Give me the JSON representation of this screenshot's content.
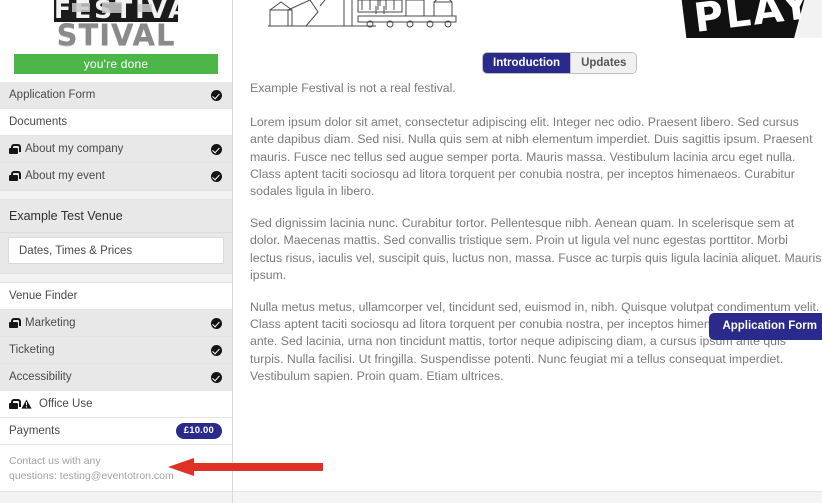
{
  "sidebar": {
    "logo": {
      "line1": "FESTIVAL",
      "line2": "STIVAL",
      "alt": "Example Festival logo"
    },
    "status_banner": {
      "label": "you're done",
      "color": "#4cb748"
    },
    "groups": [
      {
        "items": [
          {
            "label": "Application Form",
            "locked": false,
            "warning": false,
            "complete": true,
            "shaded": true
          },
          {
            "label": "Documents",
            "locked": false,
            "warning": false,
            "complete": false,
            "shaded": false
          },
          {
            "label": "About my company",
            "locked": true,
            "warning": false,
            "complete": true,
            "shaded": true
          },
          {
            "label": "About my event",
            "locked": true,
            "warning": false,
            "complete": true,
            "shaded": true
          }
        ]
      }
    ],
    "venue": {
      "title": "Example Test Venue",
      "sub_items": [
        {
          "label": "Dates, Times & Prices"
        }
      ]
    },
    "groups2": {
      "items": [
        {
          "label": "Venue Finder",
          "locked": false,
          "warning": false,
          "complete": false,
          "shaded": false
        },
        {
          "label": "Marketing",
          "locked": true,
          "warning": false,
          "complete": true,
          "shaded": true
        },
        {
          "label": "Ticketing",
          "locked": false,
          "warning": false,
          "complete": true,
          "shaded": true
        },
        {
          "label": "Accessibility",
          "locked": false,
          "warning": false,
          "complete": true,
          "shaded": true
        },
        {
          "label": "Office Use",
          "locked": true,
          "warning": true,
          "complete": false,
          "shaded": false
        }
      ]
    },
    "payments": {
      "label": "Payments",
      "badge": "£10.00",
      "badge_color": "#2a2a8c"
    },
    "contact": {
      "line1": "Contact us with any",
      "line2_prefix": "questions: ",
      "email": "testing@eventotron.com"
    }
  },
  "main": {
    "tabs": [
      {
        "label": "Introduction",
        "active": true
      },
      {
        "label": "Updates",
        "active": false
      }
    ],
    "active_tab_color": "#2a2a8c",
    "lead": "Example Festival is not a real festival.",
    "paragraphs": [
      "Lorem ipsum dolor sit amet, consectetur adipiscing elit. Integer nec odio. Praesent libero. Sed cursus ante dapibus diam. Sed nisi. Nulla quis sem at nibh elementum imperdiet. Duis sagittis ipsum. Praesent mauris. Fusce nec tellus sed augue semper porta. Mauris massa. Vestibulum lacinia arcu eget nulla. Class aptent taciti sociosqu ad litora torquent per conubia nostra, per inceptos himenaeos. Curabitur sodales ligula in libero.",
      "Sed dignissim lacinia nunc. Curabitur tortor. Pellentesque nibh. Aenean quam. In scelerisque sem at dolor. Maecenas mattis. Sed convallis tristique sem. Proin ut ligula vel nunc egestas porttitor. Morbi lectus risus, iaculis vel, suscipit quis, luctus non, massa. Fusce ac turpis quis ligula lacinia aliquet. Mauris ipsum.",
      "Nulla metus metus, ullamcorper vel, tincidunt sed, euismod in, nibh. Quisque volutpat condimentum velit. Class aptent taciti sociosqu ad litora torquent per conubia nostra, per inceptos himenaeos. Nam nec ante. Sed lacinia, urna non tincidunt mattis, tortor neque adipiscing diam, a cursus ipsum ante quis turpis. Nulla facilisi. Ut fringilla. Suspendisse potenti. Nunc feugiat mi a tellus consequat imperdiet. Vestibulum sapien. Proin quam. Etiam ultrices."
    ],
    "cta": {
      "label": "Application Form"
    },
    "hero_banner_text": "PLAY"
  },
  "annotation": {
    "arrow_color": "#e03126",
    "direction": "left"
  }
}
